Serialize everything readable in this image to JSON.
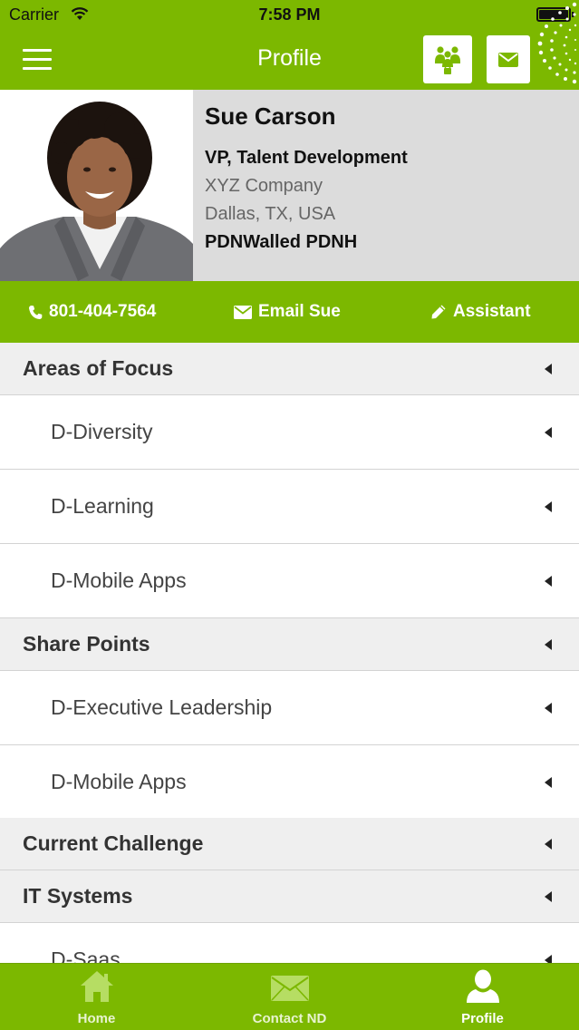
{
  "status_bar": {
    "carrier": "Carrier",
    "time": "7:58 PM"
  },
  "nav": {
    "title": "Profile",
    "menu_icon": "hamburger-menu-icon",
    "buttons": [
      "people-icon",
      "mail-icon"
    ]
  },
  "profile": {
    "name": "Sue Carson",
    "title": "VP, Talent Development",
    "company": "XYZ Company",
    "location": "Dallas, TX, USA",
    "group": "PDNWalled PDNH"
  },
  "actions": {
    "phone": "801-404-7564",
    "email": "Email Sue",
    "assistant": "Assistant"
  },
  "list": {
    "areas_of_focus": {
      "label": "Areas of Focus",
      "items": [
        "D-Diversity",
        "D-Learning",
        "D-Mobile Apps"
      ]
    },
    "share_points": {
      "label": "Share Points",
      "items": [
        "D-Executive Leadership",
        "D-Mobile Apps"
      ]
    },
    "current_challenge": {
      "label": "Current Challenge"
    },
    "it_systems": {
      "label": "IT Systems",
      "items": [
        "D-Saas"
      ]
    }
  },
  "tabs": [
    {
      "label": "Home",
      "icon": "home-icon"
    },
    {
      "label": "Contact ND",
      "icon": "envelope-icon"
    },
    {
      "label": "Profile",
      "icon": "user-icon",
      "active": true
    }
  ],
  "colors": {
    "brand_green": "#7cb800",
    "section_bg": "#efefef",
    "profile_bg": "#dcdcdc"
  }
}
